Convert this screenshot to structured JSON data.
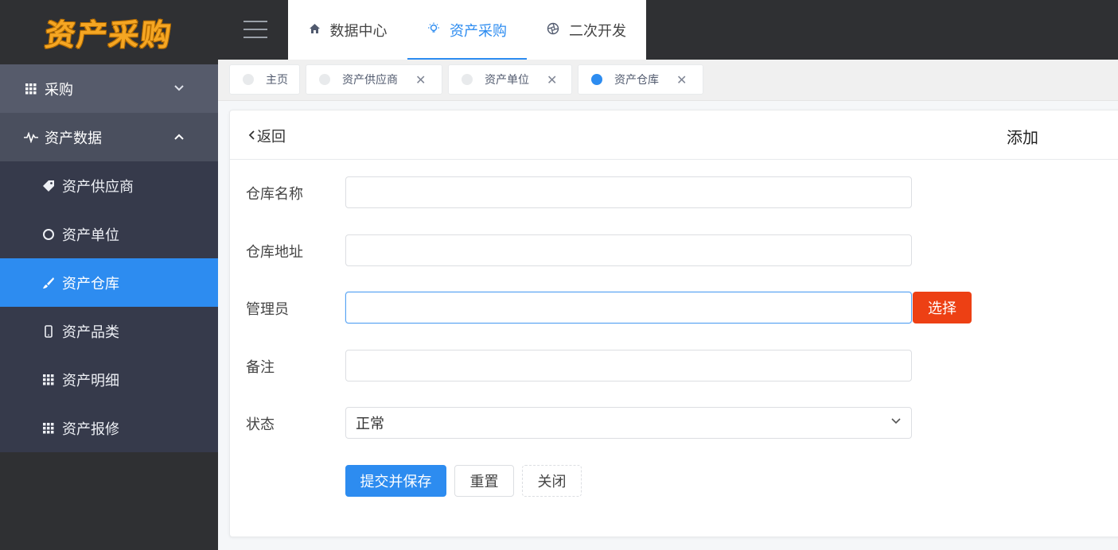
{
  "app": {
    "logo_text": "资产采购"
  },
  "sidebar": {
    "groups": [
      {
        "label": "采购",
        "icon": "grid-icon",
        "expanded": false
      },
      {
        "label": "资产数据",
        "icon": "pulse-icon",
        "expanded": true
      }
    ],
    "items": [
      {
        "label": "资产供应商",
        "icon": "tag-icon"
      },
      {
        "label": "资产单位",
        "icon": "circle-icon"
      },
      {
        "label": "资产仓库",
        "icon": "brush-icon",
        "active": true
      },
      {
        "label": "资产品类",
        "icon": "phone-icon"
      },
      {
        "label": "资产明细",
        "icon": "grid-icon"
      },
      {
        "label": "资产报修",
        "icon": "grid-icon"
      }
    ]
  },
  "topnav": {
    "tabs": [
      {
        "label": "数据中心",
        "icon": "home-icon"
      },
      {
        "label": "资产采购",
        "icon": "bulb-icon",
        "active": true
      },
      {
        "label": "二次开发",
        "icon": "aperture-icon"
      }
    ]
  },
  "pagetabs": [
    {
      "label": "主页",
      "closable": false
    },
    {
      "label": "资产供应商",
      "closable": true
    },
    {
      "label": "资产单位",
      "closable": true
    },
    {
      "label": "资产仓库",
      "closable": true,
      "active": true
    }
  ],
  "card": {
    "back_label": "返回",
    "title": "添加"
  },
  "form": {
    "name_label": "仓库名称",
    "name_value": "",
    "address_label": "仓库地址",
    "address_value": "",
    "manager_label": "管理员",
    "manager_value": "",
    "select_button": "选择",
    "remark_label": "备注",
    "remark_value": "",
    "status_label": "状态",
    "status_value": "正常"
  },
  "actions": {
    "submit": "提交并保存",
    "reset": "重置",
    "close": "关闭"
  },
  "colors": {
    "accent": "#2d8cf0",
    "danger": "#ed4014",
    "sidebar_bg": "#2f3033",
    "submenu_bg": "#363a4b",
    "logo": "#f5a623"
  }
}
